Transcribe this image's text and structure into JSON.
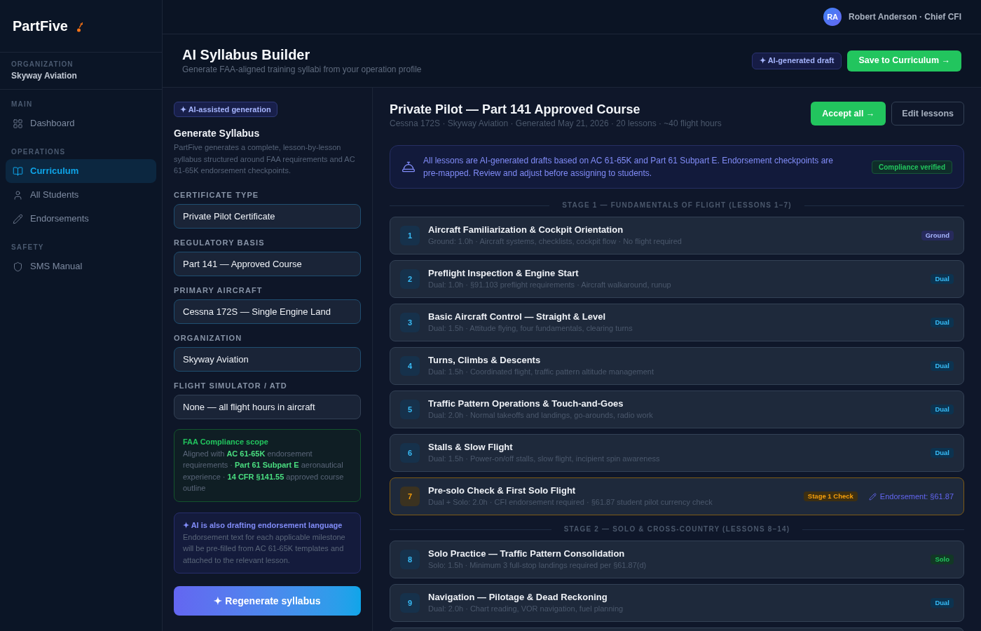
{
  "topbar": {
    "avatar": "RA",
    "user": "Robert Anderson · Chief CFI"
  },
  "sidebar": {
    "logo": "PartFive",
    "organization": {
      "label": "ORGANIZATION",
      "name": "Skyway Aviation"
    },
    "sections": [
      {
        "heading": "MAIN",
        "items": [
          {
            "label": "Dashboard",
            "selected": false
          }
        ]
      },
      {
        "heading": "OPERATIONS",
        "items": [
          {
            "label": "Curriculum",
            "selected": true
          },
          {
            "label": "All Students",
            "selected": false
          },
          {
            "label": "Endorsements",
            "selected": false
          }
        ]
      },
      {
        "heading": "SAFETY",
        "items": [
          {
            "label": "SMS Manual",
            "selected": false
          }
        ]
      }
    ]
  },
  "header": {
    "title": "AI Syllabus Builder",
    "subtitle": "Generate FAA-aligned training syllabi from your operation profile",
    "badge": "✦ AI-generated draft",
    "save_button": "Save to Curriculum →"
  },
  "form": {
    "badge": "✦ AI-assisted generation",
    "title": "Generate Syllabus",
    "description": "PartFive generates a complete, lesson-by-lesson syllabus structured around FAA requirements and AC 61-65K endorsement checkpoints.",
    "fields": [
      {
        "label": "CERTIFICATE TYPE",
        "value": "Private Pilot Certificate",
        "highlighted": true
      },
      {
        "label": "REGULATORY BASIS",
        "value": "Part 141 — Approved Course",
        "highlighted": true
      },
      {
        "label": "PRIMARY AIRCRAFT",
        "value": "Cessna 172S — Single Engine Land",
        "highlighted": true
      },
      {
        "label": "ORGANIZATION",
        "value": "Skyway Aviation",
        "highlighted": true
      },
      {
        "label": "FLIGHT SIMULATOR / ATD",
        "value": "None — all flight hours in aircraft",
        "highlighted": false
      }
    ],
    "compliance": {
      "title": "FAA Compliance scope",
      "text": "Aligned with **AC 61-65K** endorsement requirements · **Part 61 Subpart E** aeronautical experience · **14 CFR §141.55** approved course outline"
    },
    "ai_note": {
      "title": "✦ AI is also drafting endorsement language",
      "text": "Endorsement text for each applicable milestone will be pre-filled from AC 61-65K templates and attached to the relevant lesson."
    },
    "regenerate_button": "✦ Regenerate syllabus"
  },
  "syllabus": {
    "title": "Private Pilot — Part 141 Approved Course",
    "meta": "Cessna 172S · Skyway Aviation · Generated May 21, 2026 · 20 lessons · ~40 flight hours",
    "accept_button": "Accept all →",
    "edit_button": "Edit lessons",
    "notice": {
      "text": "All lessons are AI-generated drafts based on AC 61-65K and Part 61 Subpart E. Endorsement checkpoints are pre-mapped. Review and adjust before assigning to students.",
      "badge": "Compliance verified"
    },
    "stages": [
      {
        "heading": "STAGE 1 — FUNDAMENTALS OF FLIGHT (LESSONS 1–7)",
        "lessons": [
          {
            "number": "1",
            "title": "Aircraft Familiarization & Cockpit Orientation",
            "detail": "Ground: 1.0h · Aircraft systems, checklists, cockpit flow · No flight required",
            "highlighted": false,
            "tags": [
              {
                "label": "Ground",
                "kind": "ground"
              }
            ]
          },
          {
            "number": "2",
            "title": "Preflight Inspection & Engine Start",
            "detail": "Dual: 1.0h · §91.103 preflight requirements · Aircraft walkaround, runup",
            "highlighted": false,
            "tags": [
              {
                "label": "Dual",
                "kind": "dual"
              }
            ]
          },
          {
            "number": "3",
            "title": "Basic Aircraft Control — Straight & Level",
            "detail": "Dual: 1.5h · Attitude flying, four fundamentals, clearing turns",
            "highlighted": false,
            "tags": [
              {
                "label": "Dual",
                "kind": "dual"
              }
            ]
          },
          {
            "number": "4",
            "title": "Turns, Climbs & Descents",
            "detail": "Dual: 1.5h · Coordinated flight, traffic pattern altitude management",
            "highlighted": false,
            "tags": [
              {
                "label": "Dual",
                "kind": "dual"
              }
            ]
          },
          {
            "number": "5",
            "title": "Traffic Pattern Operations & Touch-and-Goes",
            "detail": "Dual: 2.0h · Normal takeoffs and landings, go-arounds, radio work",
            "highlighted": false,
            "tags": [
              {
                "label": "Dual",
                "kind": "dual"
              }
            ]
          },
          {
            "number": "6",
            "title": "Stalls & Slow Flight",
            "detail": "Dual: 1.5h · Power-on/off stalls, slow flight, incipient spin awareness",
            "highlighted": false,
            "tags": [
              {
                "label": "Dual",
                "kind": "dual"
              }
            ]
          },
          {
            "number": "7",
            "title": "Pre-solo Check & First Solo Flight",
            "detail": "Dual + Solo: 2.0h · CFI endorsement required · §61.87 student pilot currency check",
            "highlighted": true,
            "tags": [
              {
                "label": "Stage 1 Check",
                "kind": "check"
              }
            ],
            "endorsement": "Endorsement: §61.87"
          }
        ]
      },
      {
        "heading": "STAGE 2 — SOLO & CROSS-COUNTRY (LESSONS 8–14)",
        "lessons": [
          {
            "number": "8",
            "title": "Solo Practice — Traffic Pattern Consolidation",
            "detail": "Solo: 1.5h · Minimum 3 full-stop landings required per §61.87(d)",
            "highlighted": false,
            "tags": [
              {
                "label": "Solo",
                "kind": "solo"
              }
            ]
          },
          {
            "number": "9",
            "title": "Navigation — Pilotage & Dead Reckoning",
            "detail": "Dual: 2.0h · Chart reading, VOR navigation, fuel planning",
            "highlighted": false,
            "tags": [
              {
                "label": "Dual",
                "kind": "dual"
              }
            ]
          }
        ]
      }
    ]
  }
}
